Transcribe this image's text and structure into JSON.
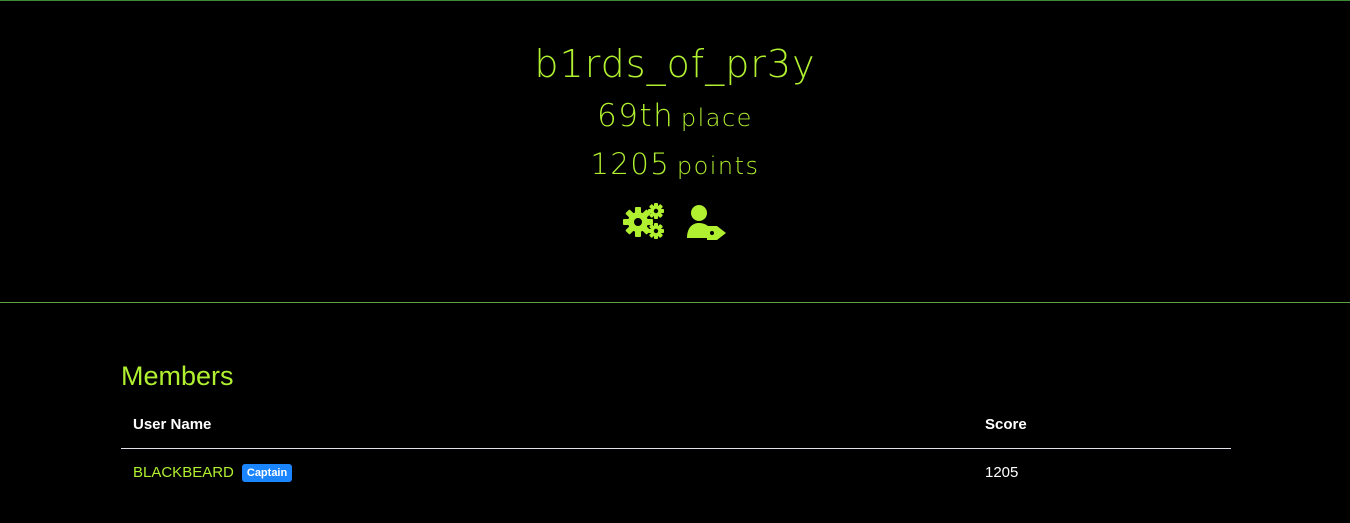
{
  "team": {
    "name": "b1rds_of_pr3y",
    "place_number": "69th",
    "place_word": "place",
    "points_number": "1205",
    "points_word": "points"
  },
  "actions": [
    {
      "icon": "gears-icon"
    },
    {
      "icon": "user-tag-icon"
    }
  ],
  "members": {
    "title": "Members",
    "columns": [
      "User Name",
      "Score"
    ],
    "rows": [
      {
        "user": "BLACKBEARD",
        "badge": "Captain",
        "score": "1205"
      }
    ]
  },
  "colors": {
    "accent": "#b0f030",
    "background": "#000000",
    "badge": "#1a85ff",
    "divider": "#5fa041"
  }
}
